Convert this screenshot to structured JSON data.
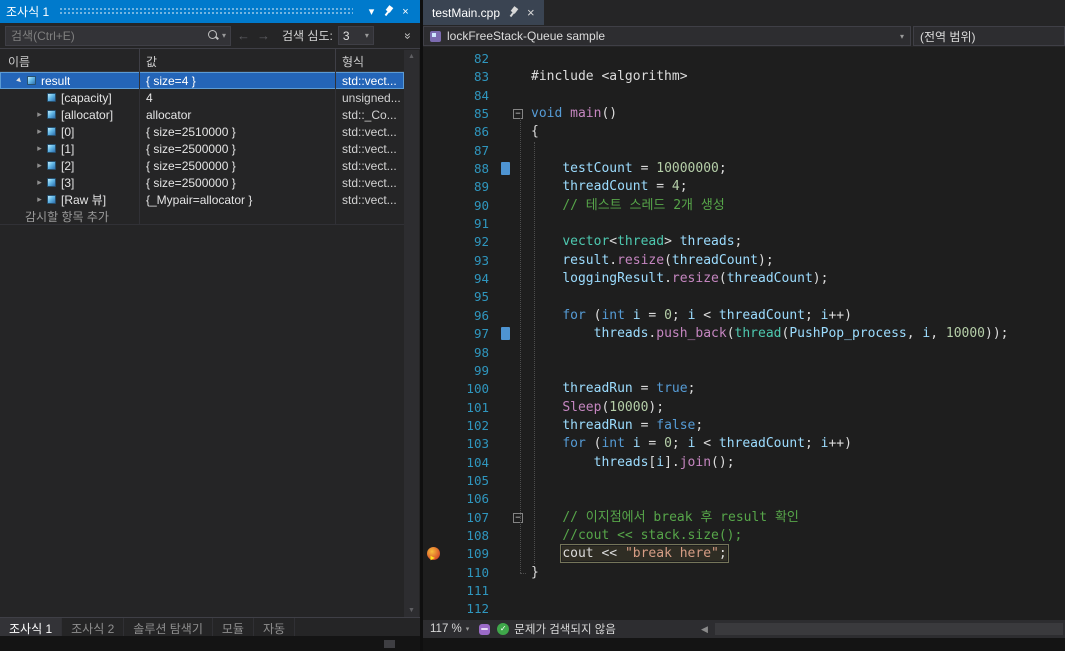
{
  "palette": {
    "titlebar": "#007acc",
    "selection_bg": "#2465b8",
    "selection_border": "#5b9bd5",
    "tokens": {
      "k": "#569cd6",
      "t": "#4ec9b0",
      "v": "#9cdcfe",
      "n": "#b5cea8",
      "c": "#57a64a",
      "s": "#d69d85",
      "p": "#dcdcdc",
      "f": "#c586c0"
    }
  },
  "watch": {
    "title": "조사식 1",
    "search_placeholder": "검색(Ctrl+E)",
    "depth_label": "검색 심도:",
    "depth_value": "3",
    "columns": [
      "이름",
      "값",
      "형식"
    ],
    "rows": [
      {
        "name": "result",
        "value": "{ size=4 }",
        "type": "std::vect...",
        "indent": 0,
        "expand": "open",
        "selected": true
      },
      {
        "name": "[capacity]",
        "value": "4",
        "type": "unsigned...",
        "indent": 1,
        "expand": "none"
      },
      {
        "name": "[allocator]",
        "value": "allocator",
        "type": "std::_Co...",
        "indent": 1,
        "expand": "closed"
      },
      {
        "name": "[0]",
        "value": "{ size=2510000 }",
        "type": "std::vect...",
        "indent": 1,
        "expand": "closed"
      },
      {
        "name": "[1]",
        "value": "{ size=2500000 }",
        "type": "std::vect...",
        "indent": 1,
        "expand": "closed"
      },
      {
        "name": "[2]",
        "value": "{ size=2500000 }",
        "type": "std::vect...",
        "indent": 1,
        "expand": "closed"
      },
      {
        "name": "[3]",
        "value": "{ size=2500000 }",
        "type": "std::vect...",
        "indent": 1,
        "expand": "closed"
      },
      {
        "name": "[Raw 뷰]",
        "value": "{_Mypair=allocator }",
        "type": "std::vect...",
        "indent": 1,
        "expand": "closed"
      },
      {
        "name": "감시할 항목 추가",
        "value": "",
        "type": "",
        "indent": 0,
        "expand": "none",
        "add": true
      }
    ],
    "tabs": [
      {
        "label": "조사식 1",
        "active": true
      },
      {
        "label": "조사식 2"
      },
      {
        "label": "솔루션 탐색기"
      },
      {
        "label": "모듈"
      },
      {
        "label": "자동"
      }
    ]
  },
  "editor": {
    "tab_title": "testMain.cpp",
    "nav_project": "lockFreeStack-Queue sample",
    "nav_scope": "(전역 범위)",
    "zoom": "117 %",
    "status_message": "문제가 검색되지 않음",
    "lines": [
      {
        "no": 82,
        "segs": []
      },
      {
        "no": 83,
        "segs": [
          [
            "#include <algorithm>",
            "p"
          ]
        ]
      },
      {
        "no": 84,
        "segs": []
      },
      {
        "no": 85,
        "fold": true,
        "segs": [
          [
            "void",
            "k"
          ],
          [
            " ",
            "p"
          ],
          [
            "main",
            "f"
          ],
          [
            "()",
            "p"
          ]
        ]
      },
      {
        "no": 86,
        "segs": [
          [
            "{",
            "p"
          ]
        ]
      },
      {
        "no": 87,
        "segs": []
      },
      {
        "no": 88,
        "glyph": true,
        "segs": [
          [
            "    ",
            "p"
          ],
          [
            "testCount",
            "v"
          ],
          [
            " = ",
            "p"
          ],
          [
            "10000000",
            "n"
          ],
          [
            ";",
            "p"
          ]
        ]
      },
      {
        "no": 89,
        "segs": [
          [
            "    ",
            "p"
          ],
          [
            "threadCount",
            "v"
          ],
          [
            " = ",
            "p"
          ],
          [
            "4",
            "n"
          ],
          [
            ";",
            "p"
          ]
        ]
      },
      {
        "no": 90,
        "segs": [
          [
            "    ",
            "p"
          ],
          [
            "// 테스트 스레드 2개 생성",
            "c"
          ]
        ]
      },
      {
        "no": 91,
        "segs": []
      },
      {
        "no": 92,
        "segs": [
          [
            "    ",
            "p"
          ],
          [
            "vector",
            "t"
          ],
          [
            "<",
            "p"
          ],
          [
            "thread",
            "t"
          ],
          [
            ">",
            "p"
          ],
          [
            " ",
            "p"
          ],
          [
            "threads",
            "v"
          ],
          [
            ";",
            "p"
          ]
        ]
      },
      {
        "no": 93,
        "segs": [
          [
            "    ",
            "p"
          ],
          [
            "result",
            "v"
          ],
          [
            ".",
            "p"
          ],
          [
            "resize",
            "f"
          ],
          [
            "(",
            "p"
          ],
          [
            "threadCount",
            "v"
          ],
          [
            ");",
            "p"
          ]
        ]
      },
      {
        "no": 94,
        "segs": [
          [
            "    ",
            "p"
          ],
          [
            "loggingResult",
            "v"
          ],
          [
            ".",
            "p"
          ],
          [
            "resize",
            "f"
          ],
          [
            "(",
            "p"
          ],
          [
            "threadCount",
            "v"
          ],
          [
            ");",
            "p"
          ]
        ]
      },
      {
        "no": 95,
        "segs": []
      },
      {
        "no": 96,
        "segs": [
          [
            "    ",
            "p"
          ],
          [
            "for",
            "k"
          ],
          [
            " (",
            "p"
          ],
          [
            "int",
            "k"
          ],
          [
            " ",
            "p"
          ],
          [
            "i",
            "v"
          ],
          [
            " = ",
            "p"
          ],
          [
            "0",
            "n"
          ],
          [
            "; ",
            "p"
          ],
          [
            "i",
            "v"
          ],
          [
            " < ",
            "p"
          ],
          [
            "threadCount",
            "v"
          ],
          [
            "; ",
            "p"
          ],
          [
            "i",
            "v"
          ],
          [
            "++)",
            "p"
          ]
        ]
      },
      {
        "no": 97,
        "glyph": true,
        "segs": [
          [
            "        ",
            "p"
          ],
          [
            "threads",
            "v"
          ],
          [
            ".",
            "p"
          ],
          [
            "push_back",
            "f"
          ],
          [
            "(",
            "p"
          ],
          [
            "thread",
            "t"
          ],
          [
            "(",
            "p"
          ],
          [
            "PushPop_process",
            "v"
          ],
          [
            ", ",
            "p"
          ],
          [
            "i",
            "v"
          ],
          [
            ", ",
            "p"
          ],
          [
            "10000",
            "n"
          ],
          [
            "));",
            "p"
          ]
        ]
      },
      {
        "no": 98,
        "segs": []
      },
      {
        "no": 99,
        "segs": []
      },
      {
        "no": 100,
        "segs": [
          [
            "    ",
            "p"
          ],
          [
            "threadRun",
            "v"
          ],
          [
            " = ",
            "p"
          ],
          [
            "true",
            "k"
          ],
          [
            ";",
            "p"
          ]
        ]
      },
      {
        "no": 101,
        "segs": [
          [
            "    ",
            "p"
          ],
          [
            "Sleep",
            "f"
          ],
          [
            "(",
            "p"
          ],
          [
            "10000",
            "n"
          ],
          [
            ");",
            "p"
          ]
        ]
      },
      {
        "no": 102,
        "segs": [
          [
            "    ",
            "p"
          ],
          [
            "threadRun",
            "v"
          ],
          [
            " = ",
            "p"
          ],
          [
            "false",
            "k"
          ],
          [
            ";",
            "p"
          ]
        ]
      },
      {
        "no": 103,
        "segs": [
          [
            "    ",
            "p"
          ],
          [
            "for",
            "k"
          ],
          [
            " (",
            "p"
          ],
          [
            "int",
            "k"
          ],
          [
            " ",
            "p"
          ],
          [
            "i",
            "v"
          ],
          [
            " = ",
            "p"
          ],
          [
            "0",
            "n"
          ],
          [
            "; ",
            "p"
          ],
          [
            "i",
            "v"
          ],
          [
            " < ",
            "p"
          ],
          [
            "threadCount",
            "v"
          ],
          [
            "; ",
            "p"
          ],
          [
            "i",
            "v"
          ],
          [
            "++)",
            "p"
          ]
        ]
      },
      {
        "no": 104,
        "segs": [
          [
            "        ",
            "p"
          ],
          [
            "threads",
            "v"
          ],
          [
            "[",
            "p"
          ],
          [
            "i",
            "v"
          ],
          [
            "]",
            "p"
          ],
          [
            ".",
            "p"
          ],
          [
            "join",
            "f"
          ],
          [
            "();",
            "p"
          ]
        ]
      },
      {
        "no": 105,
        "segs": []
      },
      {
        "no": 106,
        "segs": []
      },
      {
        "no": 107,
        "fold": true,
        "segs": [
          [
            "    ",
            "p"
          ],
          [
            "// 이지점에서 break 후 result 확인",
            "c"
          ]
        ]
      },
      {
        "no": 108,
        "segs": [
          [
            "    ",
            "p"
          ],
          [
            "//cout << stack.size();",
            "c"
          ]
        ]
      },
      {
        "no": 109,
        "current": true,
        "segs": [
          [
            "    ",
            "p"
          ],
          [
            "cout",
            "p"
          ],
          [
            " << ",
            "p"
          ],
          [
            "\"break here\"",
            "s"
          ],
          [
            ";",
            "p"
          ]
        ]
      },
      {
        "no": 110,
        "segs": [
          [
            "}",
            "p"
          ]
        ]
      },
      {
        "no": 111,
        "segs": []
      },
      {
        "no": 112,
        "segs": []
      }
    ]
  }
}
